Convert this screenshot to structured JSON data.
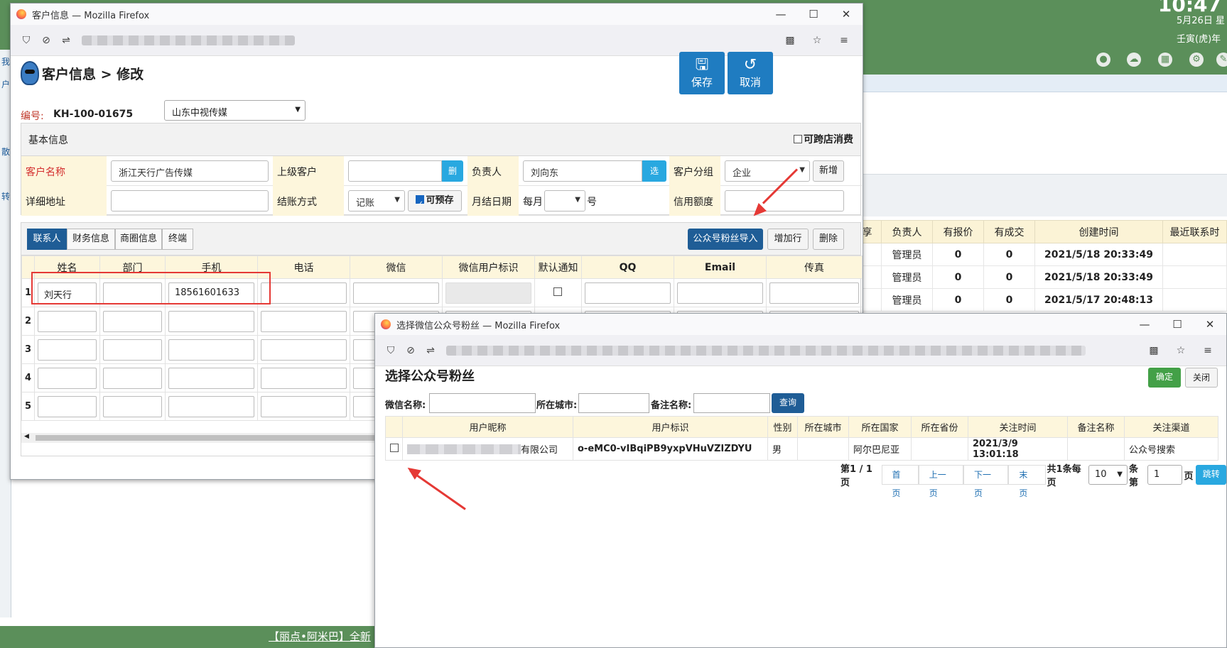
{
  "background": {
    "clock": "10:47",
    "date": "5月26日 星",
    "lunar": "壬寅(虎)年",
    "left_letters": [
      "我",
      "户",
      "散",
      "转"
    ],
    "table": {
      "headers": [
        "享",
        "负责人",
        "有报价",
        "有成交",
        "创建时间",
        "最近联系时"
      ],
      "rows": [
        [
          "",
          "管理员",
          "0",
          "0",
          "2021/5/18 20:33:49",
          ""
        ],
        [
          "",
          "管理员",
          "0",
          "0",
          "2021/5/18 20:33:49",
          ""
        ],
        [
          "",
          "管理员",
          "0",
          "0",
          "2021/5/17 20:48:13",
          ""
        ]
      ]
    },
    "bottom_text": "【丽点•阿米巴】全新"
  },
  "main_window": {
    "title": "客户信息 — Mozilla Firefox",
    "page_title": "客户信息 > 修改",
    "save_label": "保存",
    "cancel_label": "取消",
    "code_label": "编号:",
    "code_value": "KH-100-01675",
    "company": "山东中视传媒",
    "basic_header": "基本信息",
    "cross_shop": "可跨店消费",
    "fields": {
      "customer_name_label": "客户名称",
      "customer_name": "浙江天行广告传媒",
      "parent_label": "上级客户",
      "parent_btn": "删",
      "owner_label": "负责人",
      "owner": "刘向东",
      "owner_btn": "选",
      "group_label": "客户分组",
      "group": "企业",
      "group_add": "新增",
      "address_label": "详细地址",
      "settle_label": "结账方式",
      "settle": "记账",
      "prestore": "可预存",
      "monthly_label": "月结日期",
      "monthly_prefix": "每月",
      "monthly_suffix": "号",
      "credit_label": "信用额度"
    },
    "tabs": [
      "联系人",
      "财务信息",
      "商圈信息",
      "终端"
    ],
    "import_btn": "公众号粉丝导入",
    "addrow_btn": "增加行",
    "delete_btn": "删除",
    "contact_headers": [
      "",
      "姓名",
      "部门",
      "手机",
      "电话",
      "微信",
      "微信用户标识",
      "默认通知",
      "QQ",
      "Email",
      "传真"
    ],
    "contact_rows": [
      {
        "n": "1",
        "name": "刘天行",
        "dept": "",
        "mobile": "18561601633"
      },
      {
        "n": "2",
        "name": "",
        "dept": "",
        "mobile": ""
      },
      {
        "n": "3",
        "name": "",
        "dept": "",
        "mobile": ""
      },
      {
        "n": "4",
        "name": "",
        "dept": "",
        "mobile": ""
      },
      {
        "n": "5",
        "name": "",
        "dept": "",
        "mobile": ""
      }
    ]
  },
  "dialog": {
    "title": "选择微信公众号粉丝 — Mozilla Firefox",
    "heading": "选择公众号粉丝",
    "confirm": "确定",
    "close": "关闭",
    "filter_wechat": "微信名称:",
    "filter_city": "所在城市:",
    "filter_remark": "备注名称:",
    "query": "查询",
    "headers": [
      "",
      "用户昵称",
      "用户标识",
      "性别",
      "所在城市",
      "所在国家",
      "所在省份",
      "关注时间",
      "备注名称",
      "关注渠道"
    ],
    "row": {
      "nickname_suffix": "有限公司",
      "openid": "o-eMC0-vIBqiPB9yxpVHuVZIZDYU",
      "gender": "男",
      "city": "",
      "country": "阿尔巴尼亚",
      "province": "",
      "follow_time": "2021/3/9 13:01:18",
      "remark": "",
      "channel": "公众号搜索"
    },
    "pager": {
      "page_info": "第1 / 1页",
      "first": "首页",
      "prev": "上一页",
      "next": "下一页",
      "last": "末页",
      "total": "共1条每页",
      "per_page": "10",
      "per_page_suffix": "条第",
      "page": "1",
      "page_suffix": "页",
      "jump": "跳转"
    }
  }
}
